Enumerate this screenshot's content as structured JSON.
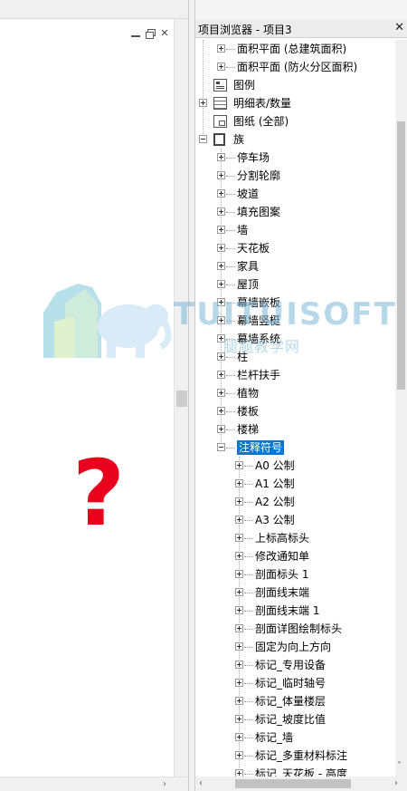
{
  "left_view": {
    "controls": {
      "minimize": "minimize",
      "restore": "restore",
      "close": "✕"
    },
    "question_mark": "?",
    "scroll_left_arrow": "‹",
    "scroll_right_arrow": "›",
    "scroll_up_arrow": "˄",
    "scroll_down_arrow": "˅"
  },
  "browser": {
    "title": "项目浏览器 - 项目3",
    "close_label": "✕",
    "scroll_up_arrow": "˄",
    "scroll_down_arrow": "˅",
    "scroll_left_arrow": "‹",
    "scroll_right_arrow": "›",
    "tree": [
      {
        "label": "面积平面 (总建筑面积)",
        "level": 2,
        "toggle": "plus"
      },
      {
        "label": "面积平面 (防火分区面积)",
        "level": 2,
        "toggle": "plus"
      },
      {
        "label": "图例",
        "level": 1,
        "toggle": "none",
        "icon": "legend"
      },
      {
        "label": "明细表/数量",
        "level": 1,
        "toggle": "plus",
        "icon": "sched"
      },
      {
        "label": "图纸 (全部)",
        "level": 1,
        "toggle": "none",
        "icon": "sheet"
      },
      {
        "label": "族",
        "level": 1,
        "toggle": "minus",
        "icon": "family"
      },
      {
        "label": "停车场",
        "level": 2,
        "toggle": "plus"
      },
      {
        "label": "分割轮廓",
        "level": 2,
        "toggle": "plus"
      },
      {
        "label": "坡道",
        "level": 2,
        "toggle": "plus"
      },
      {
        "label": "填充图案",
        "level": 2,
        "toggle": "plus"
      },
      {
        "label": "墙",
        "level": 2,
        "toggle": "plus"
      },
      {
        "label": "天花板",
        "level": 2,
        "toggle": "plus"
      },
      {
        "label": "家具",
        "level": 2,
        "toggle": "plus"
      },
      {
        "label": "屋顶",
        "level": 2,
        "toggle": "plus"
      },
      {
        "label": "幕墙嵌板",
        "level": 2,
        "toggle": "plus"
      },
      {
        "label": "幕墙竖梃",
        "level": 2,
        "toggle": "plus"
      },
      {
        "label": "幕墙系统",
        "level": 2,
        "toggle": "plus"
      },
      {
        "label": "柱",
        "level": 2,
        "toggle": "plus"
      },
      {
        "label": "栏杆扶手",
        "level": 2,
        "toggle": "plus"
      },
      {
        "label": "植物",
        "level": 2,
        "toggle": "plus"
      },
      {
        "label": "楼板",
        "level": 2,
        "toggle": "plus"
      },
      {
        "label": "楼梯",
        "level": 2,
        "toggle": "plus"
      },
      {
        "label": "注释符号",
        "level": 2,
        "toggle": "minus",
        "selected": true
      },
      {
        "label": "A0 公制",
        "level": 3,
        "toggle": "plus"
      },
      {
        "label": "A1 公制",
        "level": 3,
        "toggle": "plus"
      },
      {
        "label": "A2 公制",
        "level": 3,
        "toggle": "plus"
      },
      {
        "label": "A3 公制",
        "level": 3,
        "toggle": "plus"
      },
      {
        "label": "上标高标头",
        "level": 3,
        "toggle": "plus"
      },
      {
        "label": "修改通知单",
        "level": 3,
        "toggle": "plus"
      },
      {
        "label": "剖面标头 1",
        "level": 3,
        "toggle": "plus"
      },
      {
        "label": "剖面线末端",
        "level": 3,
        "toggle": "plus"
      },
      {
        "label": "剖面线末端 1",
        "level": 3,
        "toggle": "plus"
      },
      {
        "label": "剖面详图绘制标头",
        "level": 3,
        "toggle": "plus"
      },
      {
        "label": "固定为向上方向",
        "level": 3,
        "toggle": "plus"
      },
      {
        "label": "标记_专用设备",
        "level": 3,
        "toggle": "plus"
      },
      {
        "label": "标记_临时轴号",
        "level": 3,
        "toggle": "plus"
      },
      {
        "label": "标记_体量楼层",
        "level": 3,
        "toggle": "plus"
      },
      {
        "label": "标记_坡度比值",
        "level": 3,
        "toggle": "plus"
      },
      {
        "label": "标记_墙",
        "level": 3,
        "toggle": "plus"
      },
      {
        "label": "标记_多重材料标注",
        "level": 3,
        "toggle": "plus"
      },
      {
        "label": "标记_天花板 - 高度",
        "level": 3,
        "toggle": "plus"
      }
    ]
  },
  "watermark": {
    "brand": "TUITUISOFT",
    "subtitle": "腿腿教学网"
  },
  "colors": {
    "selection": "#0078d7",
    "question_mark": "#e8001c",
    "watermark": "#7bb9d6"
  }
}
